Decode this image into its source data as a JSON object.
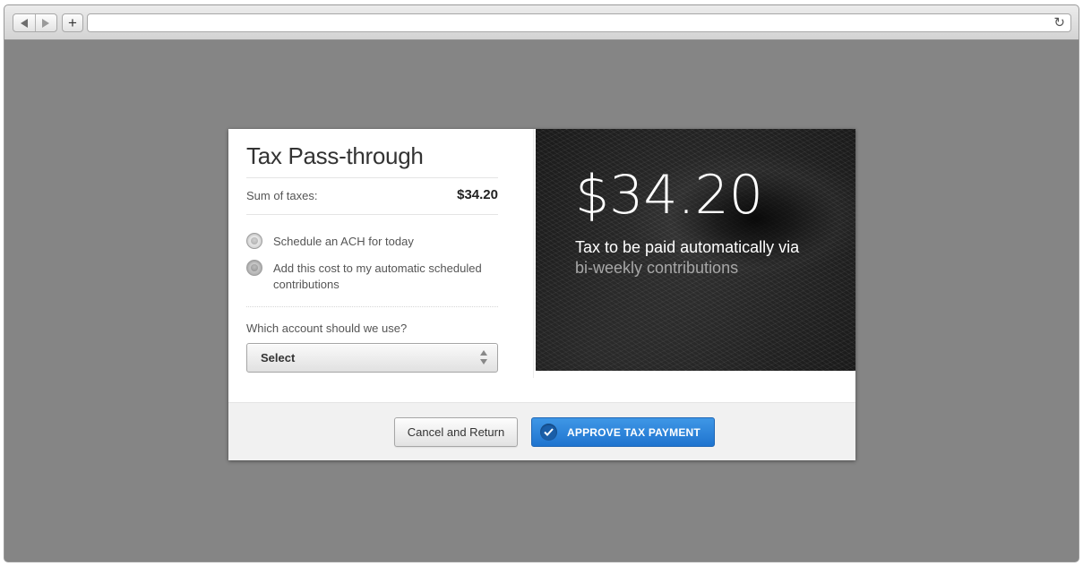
{
  "browser": {
    "back_icon": "triangle-left",
    "forward_icon": "triangle-right",
    "new_tab_label": "+",
    "address_value": "",
    "reload_icon": "↻"
  },
  "modal": {
    "title": "Tax Pass-through",
    "sum_label": "Sum of taxes:",
    "sum_value": "$34.20",
    "options": [
      {
        "label": "Schedule an ACH for today",
        "selected": false
      },
      {
        "label": "Add this cost to my automatic scheduled contributions",
        "selected": true
      }
    ],
    "account_question": "Which account should we use?",
    "account_select": {
      "value": "Select"
    },
    "hero": {
      "amount": "$34.20",
      "line1": "Tax to be paid automatically via",
      "line2": "bi-weekly contributions"
    },
    "footer": {
      "cancel_label": "Cancel and Return",
      "approve_label": "APPROVE TAX PAYMENT"
    }
  },
  "colors": {
    "backdrop": "#858585",
    "approve_button": "#2a83dc",
    "hero_background": "#1c1c1c"
  }
}
